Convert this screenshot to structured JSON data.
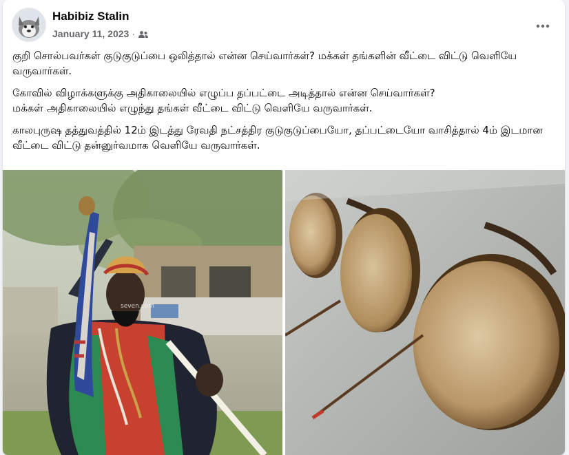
{
  "post": {
    "author": "Habibiz Stalin",
    "date": "January 11, 2023",
    "separator": "·",
    "audience_icon": "friends-icon",
    "more_icon": "more-options-icon",
    "paragraphs": [
      "குறி சொல்பவர்கள் குடுகுடுப்பை ஒலித்தால் என்ன செய்வார்கள்? மக்கள் தங்களின் வீட்டை விட்டு வெளியே வருவார்கள்.",
      "கோவில் விழாக்களுக்கு அதிகாலையில் எழுப்ப தப்பட்டை அடித்தால் என்ன செய்வார்கள்?",
      "மக்கள் அதிகாலையில் எழுந்து தங்கள் வீட்டை விட்டு வெளியே வருவார்கள்.",
      "காலபுருஷ தத்துவத்தில் 12ம் இடத்து ரேவதி நட்சத்திர குடுகுடுப்பையோ, தப்பட்டையோ வாசித்தால் 4ம் இடமான வீட்டை விட்டு தன்னுர்வமாக வெளியே வருவார்கள்."
    ],
    "photos": [
      {
        "name": "fortune-teller-photo",
        "watermark": "seven.com"
      },
      {
        "name": "kudukuduppai-drums-photo"
      }
    ]
  },
  "colors": {
    "page_bg": "#f0f2f5",
    "card_bg": "#ffffff",
    "text_primary": "#050505",
    "text_secondary": "#65676b"
  }
}
